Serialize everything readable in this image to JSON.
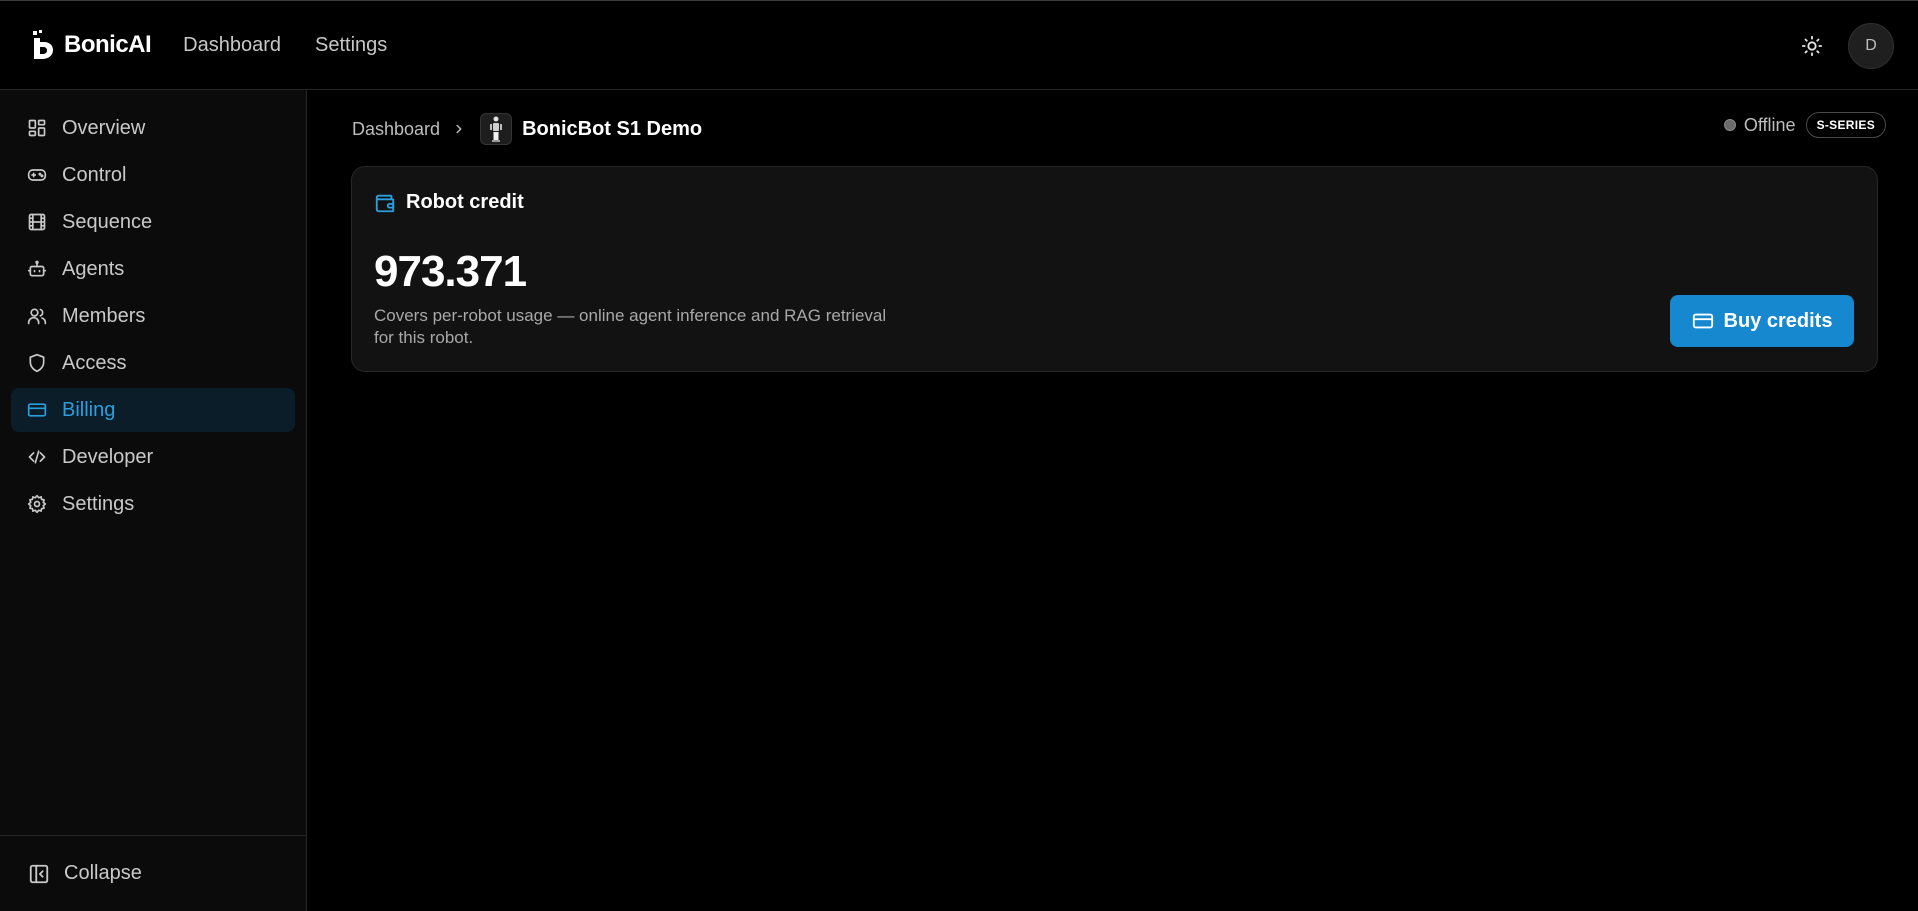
{
  "header": {
    "brand_name": "BonicAI",
    "nav": [
      {
        "label": "Dashboard"
      },
      {
        "label": "Settings"
      }
    ],
    "theme_icon": "sun-icon",
    "avatar_initial": "D"
  },
  "sidebar": {
    "items": [
      {
        "label": "Overview",
        "icon": "grid-icon"
      },
      {
        "label": "Control",
        "icon": "gamepad-icon"
      },
      {
        "label": "Sequence",
        "icon": "film-icon"
      },
      {
        "label": "Agents",
        "icon": "robot-icon"
      },
      {
        "label": "Members",
        "icon": "users-icon"
      },
      {
        "label": "Access",
        "icon": "shield-icon"
      },
      {
        "label": "Billing",
        "icon": "credit-card-icon",
        "active": true
      },
      {
        "label": "Developer",
        "icon": "code-icon"
      },
      {
        "label": "Settings",
        "icon": "gear-icon"
      }
    ],
    "collapse_label": "Collapse"
  },
  "breadcrumb": {
    "parent": "Dashboard",
    "current": "BonicBot S1 Demo"
  },
  "status": {
    "text": "Offline",
    "badge": "S-SERIES"
  },
  "credit_card": {
    "title": "Robot credit",
    "value": "973.371",
    "description": "Covers per-robot usage — online agent inference and RAG retrieval for this robot.",
    "button_label": "Buy credits"
  },
  "colors": {
    "accent": "#1588d0",
    "active_text": "#2a9fe0",
    "background": "#000000"
  }
}
